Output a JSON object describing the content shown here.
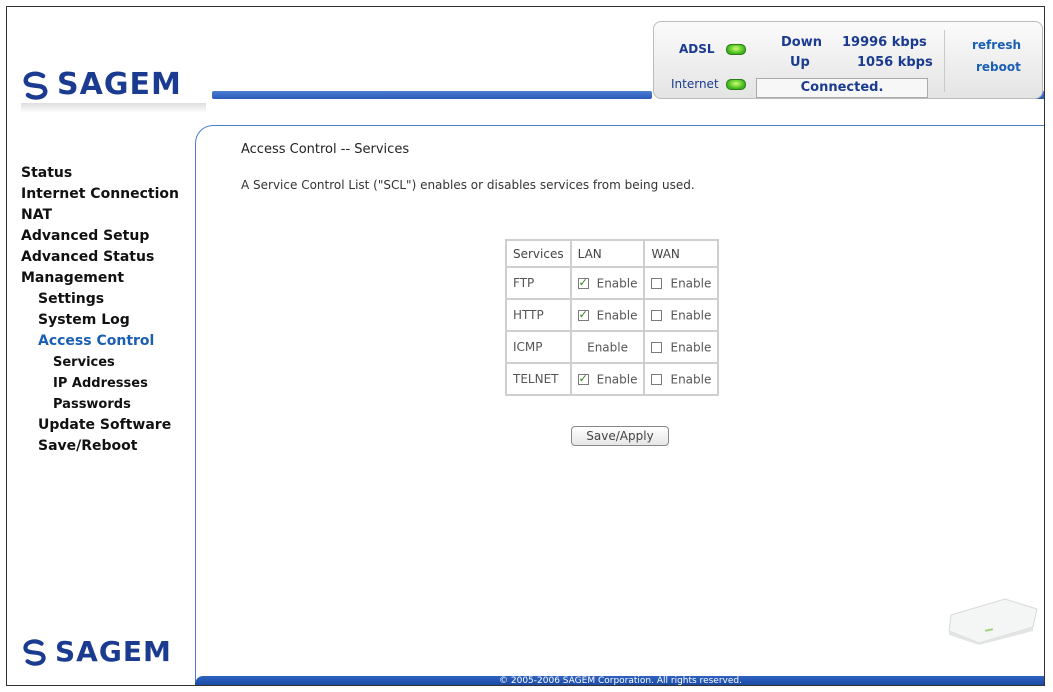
{
  "header": {
    "logo_text": "SAGEM",
    "adsl_label": "ADSL",
    "internet_label": "Internet",
    "down_label": "Down",
    "down_value": "19996 kbps",
    "up_label": "Up",
    "up_value": "1056 kbps",
    "connection_status": "Connected.",
    "refresh_label": "refresh",
    "reboot_label": "reboot",
    "led_color": "#3bb21c"
  },
  "sidebar": {
    "items": [
      {
        "label": "Status"
      },
      {
        "label": "Internet Connection"
      },
      {
        "label": "NAT"
      },
      {
        "label": "Advanced Setup"
      },
      {
        "label": "Advanced Status"
      },
      {
        "label": "Management"
      },
      {
        "label": "Settings"
      },
      {
        "label": "System Log"
      },
      {
        "label": "Access Control"
      },
      {
        "label": "Services"
      },
      {
        "label": "IP Addresses"
      },
      {
        "label": "Passwords"
      },
      {
        "label": "Update Software"
      },
      {
        "label": "Save/Reboot"
      }
    ],
    "bottom_logo_text": "SAGEM"
  },
  "main": {
    "title": "Access Control -- Services",
    "description": "A Service Control List (\"SCL\") enables or disables services from being used.",
    "table": {
      "headers": [
        "Services",
        "LAN",
        "WAN"
      ],
      "rows": [
        {
          "service": "FTP",
          "lan_label": "Enable",
          "lan_checked": true,
          "wan_label": "Enable",
          "wan_checked": false
        },
        {
          "service": "HTTP",
          "lan_label": "Enable",
          "lan_checked": true,
          "wan_label": "Enable",
          "wan_checked": false
        },
        {
          "service": "ICMP",
          "lan_label": "Enable",
          "lan_checked": null,
          "wan_label": "Enable",
          "wan_checked": false
        },
        {
          "service": "TELNET",
          "lan_label": "Enable",
          "lan_checked": true,
          "wan_label": "Enable",
          "wan_checked": false
        }
      ]
    },
    "save_button_label": "Save/Apply"
  },
  "footer": {
    "copyright": "© 2005-2006 SAGEM Corporation. All rights reserved."
  },
  "colors": {
    "brand_blue": "#1a3b8f",
    "accent_blue": "#2f62c0",
    "link_blue": "#1a5fb4"
  }
}
